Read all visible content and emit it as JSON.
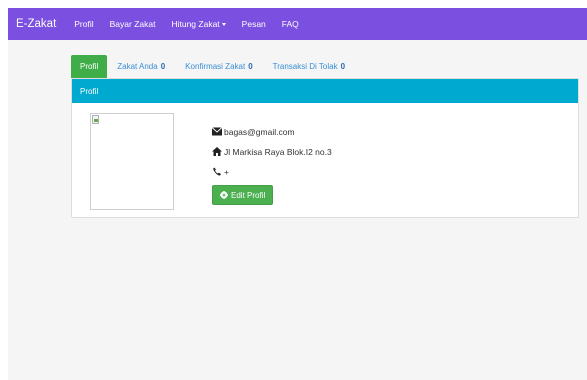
{
  "navbar": {
    "brand": "E-Zakat",
    "items": [
      {
        "label": "Profil"
      },
      {
        "label": "Bayar Zakat"
      },
      {
        "label": "Hitung Zakat",
        "dropdown": true
      },
      {
        "label": "Pesan"
      },
      {
        "label": "FAQ"
      }
    ]
  },
  "tabs": [
    {
      "label": "Profil",
      "active": true
    },
    {
      "label": "Zakat Anda",
      "count": "0"
    },
    {
      "label": "Konfirmasi Zakat",
      "count": "0"
    },
    {
      "label": "Transaksi Di Tolak",
      "count": "0"
    }
  ],
  "panel": {
    "heading": "Profil",
    "email": "bagas@gmail.com",
    "address": "Jl Markisa Raya Blok.I2 no.3",
    "phone": "+",
    "edit_button": "Edit Profil"
  },
  "icons": {
    "email": "envelope-icon",
    "address": "home-icon",
    "phone": "phone-icon",
    "edit": "cog-icon"
  },
  "colors": {
    "navbar": "#7b4fe0",
    "active_tab": "#3fae49",
    "panel_heading": "#00a9cf",
    "edit_button": "#4cb050"
  }
}
